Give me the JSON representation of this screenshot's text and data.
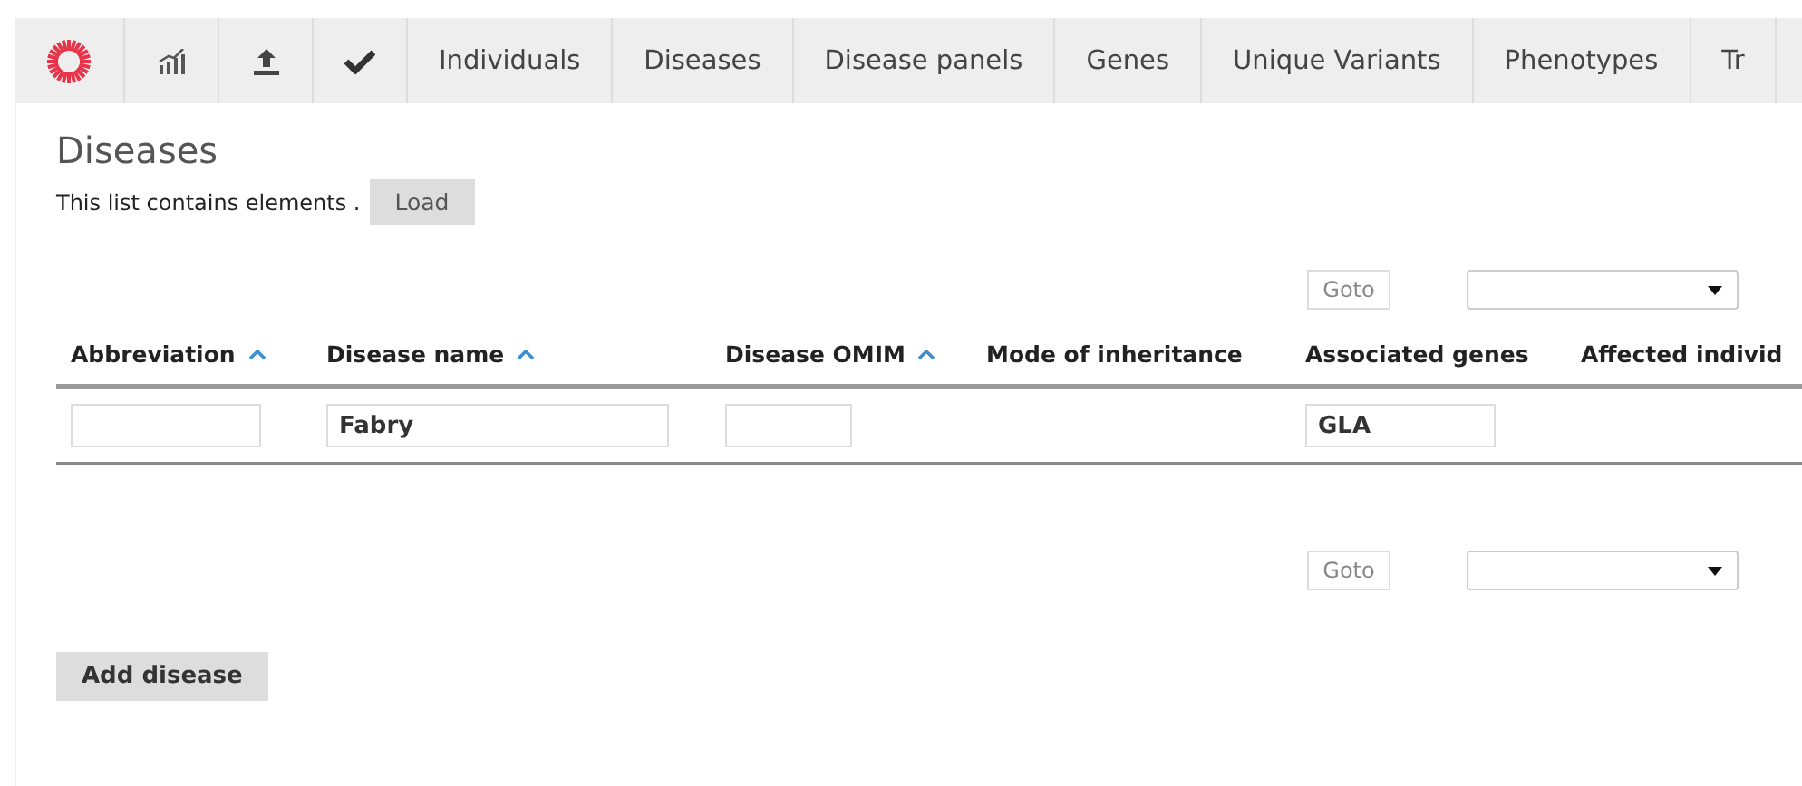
{
  "nav": {
    "icons": [
      {
        "kind": "logo"
      },
      {
        "kind": "chart"
      },
      {
        "kind": "upload"
      },
      {
        "kind": "check"
      }
    ],
    "tabs": [
      {
        "label": "Individuals"
      },
      {
        "label": "Diseases"
      },
      {
        "label": "Disease panels"
      },
      {
        "label": "Genes"
      },
      {
        "label": "Unique Variants"
      },
      {
        "label": "Phenotypes"
      },
      {
        "label": "Tr"
      }
    ]
  },
  "page": {
    "title": "Diseases",
    "info": "This list contains elements .",
    "load_button": "Load"
  },
  "pager_top": {
    "goto": "Goto"
  },
  "table": {
    "columns": [
      {
        "label": "Abbreviation",
        "sortable": true
      },
      {
        "label": "Disease name",
        "sortable": true
      },
      {
        "label": "Disease OMIM",
        "sortable": true
      },
      {
        "label": "Mode of inheritance",
        "sortable": false
      },
      {
        "label": "Associated genes",
        "sortable": false
      },
      {
        "label": "Affected individ",
        "sortable": false
      }
    ],
    "rows": [
      [
        {
          "kind": "field"
        },
        {
          "kind": "field",
          "value": "Fabry"
        },
        {
          "kind": "field"
        },
        {
          "kind": "blank"
        },
        {
          "kind": "field",
          "value": "GLA"
        },
        {
          "kind": "blank"
        }
      ]
    ]
  },
  "pager_bottom": {
    "goto": "Goto"
  },
  "add_button": "Add disease"
}
